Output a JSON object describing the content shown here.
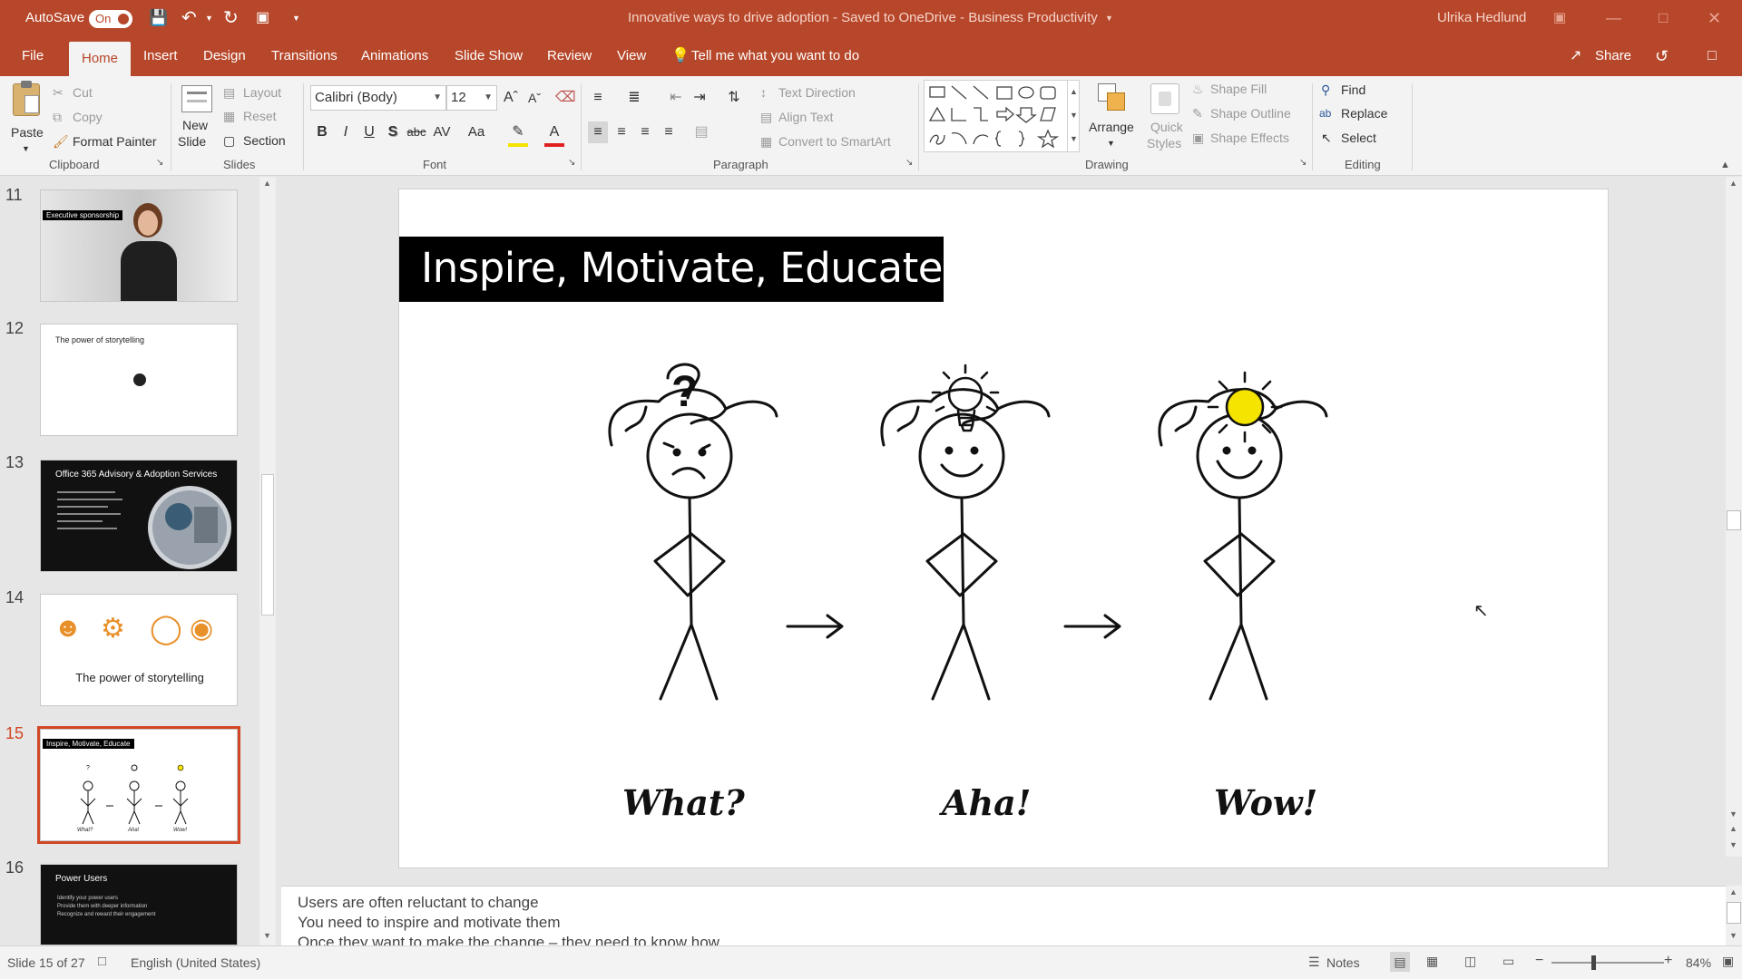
{
  "titlebar": {
    "autosave_label": "AutoSave",
    "autosave_state": "On",
    "document_title": "Innovative ways to drive adoption  -  Saved to OneDrive - Business Productivity",
    "user_name": "Ulrika Hedlund"
  },
  "tabs": [
    "File",
    "Home",
    "Insert",
    "Design",
    "Transitions",
    "Animations",
    "Slide Show",
    "Review",
    "View"
  ],
  "tell_me": "Tell me what you want to do",
  "share_label": "Share",
  "ribbon": {
    "clipboard": {
      "paste": "Paste",
      "cut": "Cut",
      "copy": "Copy",
      "format_painter": "Format Painter",
      "group": "Clipboard"
    },
    "slides": {
      "new_slide_1": "New",
      "new_slide_2": "Slide",
      "layout": "Layout",
      "reset": "Reset",
      "section": "Section",
      "group": "Slides"
    },
    "font": {
      "name": "Calibri (Body)",
      "size": "12",
      "group": "Font"
    },
    "paragraph": {
      "text_direction": "Text Direction",
      "align_text": "Align Text",
      "convert_smartart": "Convert to SmartArt",
      "group": "Paragraph"
    },
    "drawing": {
      "arrange": "Arrange",
      "quick_styles_1": "Quick",
      "quick_styles_2": "Styles",
      "shape_fill": "Shape Fill",
      "shape_outline": "Shape Outline",
      "shape_effects": "Shape Effects",
      "group": "Drawing"
    },
    "editing": {
      "find": "Find",
      "replace": "Replace",
      "select": "Select",
      "group": "Editing"
    }
  },
  "thumbnails": [
    {
      "num": "11",
      "title": "Executive sponsorship"
    },
    {
      "num": "12",
      "title": "The power of storytelling"
    },
    {
      "num": "13",
      "title": "Office 365 Advisory & Adoption Services"
    },
    {
      "num": "14",
      "title": "The power of storytelling"
    },
    {
      "num": "15",
      "title": "Inspire, Motivate, Educate",
      "cap1": "What?",
      "cap2": "Aha!",
      "cap3": "Wow!"
    },
    {
      "num": "16",
      "title": "Power Users",
      "bullets": [
        "Identify your power users",
        "Provide them with deeper information",
        "Recognize and reward their engagement"
      ]
    }
  ],
  "slide": {
    "title": "Inspire, Motivate, Educate",
    "captions": [
      "What?",
      "Aha!",
      "Wow!"
    ],
    "question_mark": "?"
  },
  "notes": [
    "Users are often reluctant to change",
    "You need to inspire and motivate them",
    "Once they want to make the change – they need to know how"
  ],
  "statusbar": {
    "slide_info": "Slide 15 of 27",
    "language": "English (United States)",
    "notes": "Notes",
    "zoom": "84%"
  },
  "colors": {
    "accent": "#b7472a",
    "selection": "#d24726",
    "bulb": "#f5e300"
  }
}
